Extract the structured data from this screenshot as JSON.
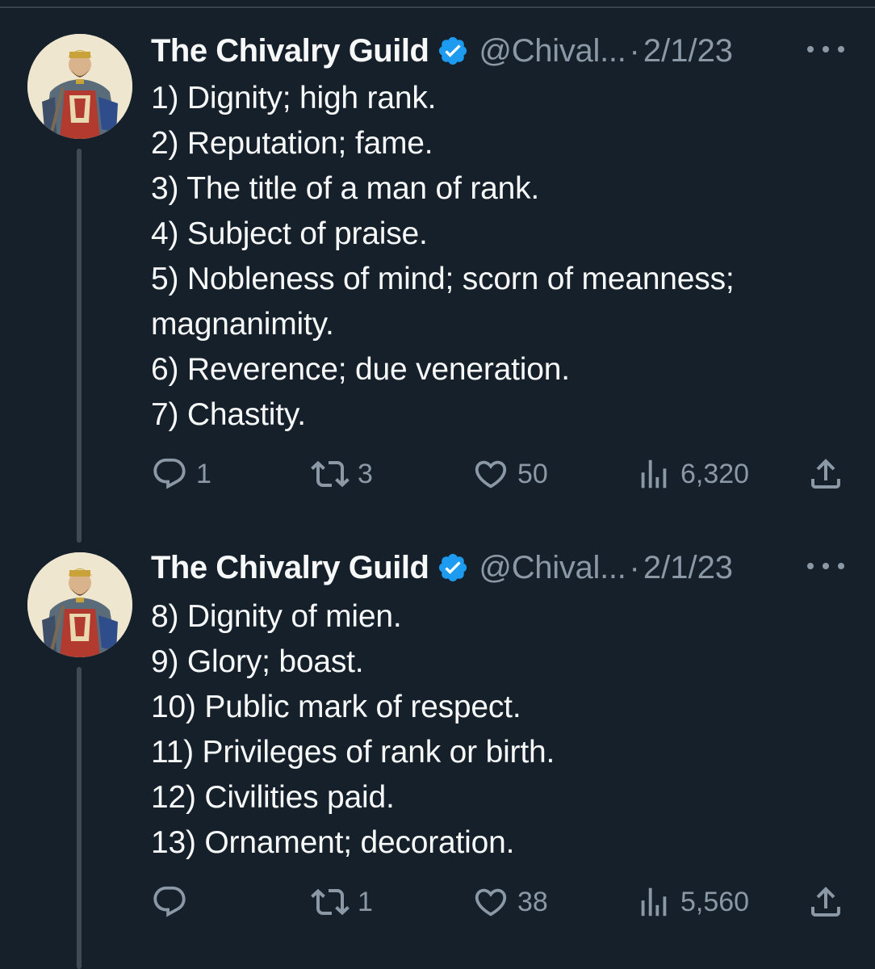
{
  "tweets": [
    {
      "display_name": "The Chivalry Guild",
      "handle": "@Chival...",
      "separator": "·",
      "date": "2/1/23",
      "lines": [
        "1) Dignity; high rank.",
        "2) Reputation; fame.",
        "3) The title of a man of rank.",
        "4) Subject of praise.",
        "5) Nobleness of mind; scorn of meanness;",
        "magnanimity.",
        "6) Reverence; due veneration.",
        "7) Chastity."
      ],
      "replies": "1",
      "retweets": "3",
      "likes": "50",
      "views": "6,320"
    },
    {
      "display_name": "The Chivalry Guild",
      "handle": "@Chival...",
      "separator": "·",
      "date": "2/1/23",
      "lines": [
        "8) Dignity of mien.",
        "9) Glory; boast.",
        "10) Public mark of respect.",
        "11) Privileges of rank or birth.",
        "12) Civilities paid.",
        "13) Ornament; decoration."
      ],
      "replies": "",
      "retweets": "1",
      "likes": "38",
      "views": "5,560"
    }
  ],
  "icons": {
    "verified": "verified-badge-icon",
    "more": "more-horizontal-icon",
    "reply": "reply-icon",
    "retweet": "retweet-icon",
    "like": "heart-icon",
    "views": "views-bar-chart-icon",
    "share": "share-icon"
  },
  "colors": {
    "background": "#15202b",
    "text": "#f7f9f9",
    "secondary": "#8b98a5",
    "verified": "#1d9bf0",
    "divider": "#38444d"
  }
}
